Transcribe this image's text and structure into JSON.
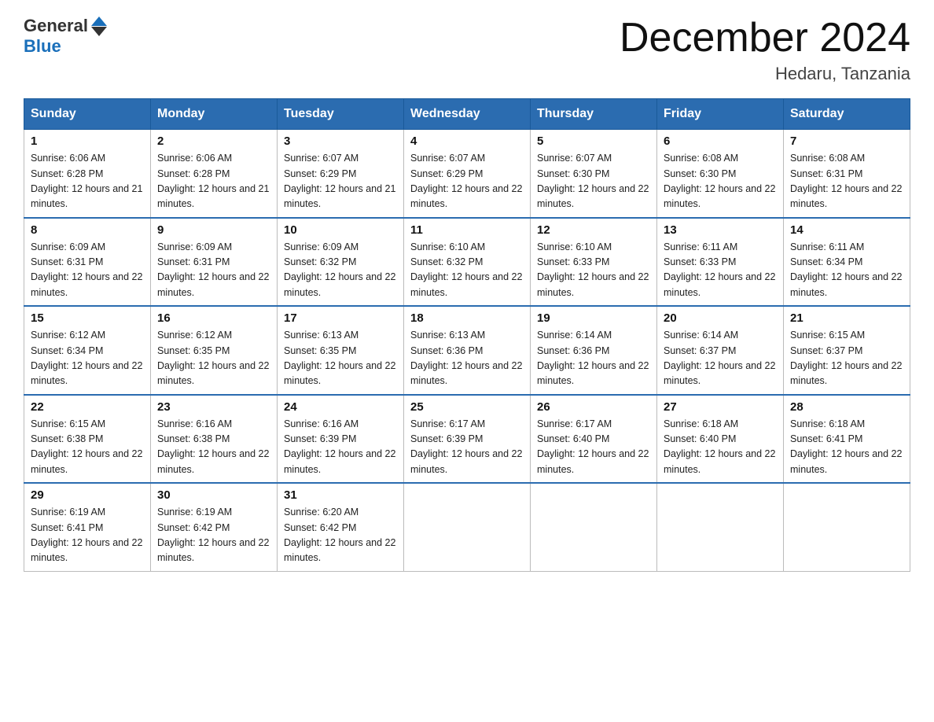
{
  "logo": {
    "text_general": "General",
    "text_blue": "Blue"
  },
  "title": "December 2024",
  "subtitle": "Hedaru, Tanzania",
  "days_of_week": [
    "Sunday",
    "Monday",
    "Tuesday",
    "Wednesday",
    "Thursday",
    "Friday",
    "Saturday"
  ],
  "weeks": [
    [
      {
        "day": "1",
        "sunrise": "6:06 AM",
        "sunset": "6:28 PM",
        "daylight": "12 hours and 21 minutes."
      },
      {
        "day": "2",
        "sunrise": "6:06 AM",
        "sunset": "6:28 PM",
        "daylight": "12 hours and 21 minutes."
      },
      {
        "day": "3",
        "sunrise": "6:07 AM",
        "sunset": "6:29 PM",
        "daylight": "12 hours and 21 minutes."
      },
      {
        "day": "4",
        "sunrise": "6:07 AM",
        "sunset": "6:29 PM",
        "daylight": "12 hours and 22 minutes."
      },
      {
        "day": "5",
        "sunrise": "6:07 AM",
        "sunset": "6:30 PM",
        "daylight": "12 hours and 22 minutes."
      },
      {
        "day": "6",
        "sunrise": "6:08 AM",
        "sunset": "6:30 PM",
        "daylight": "12 hours and 22 minutes."
      },
      {
        "day": "7",
        "sunrise": "6:08 AM",
        "sunset": "6:31 PM",
        "daylight": "12 hours and 22 minutes."
      }
    ],
    [
      {
        "day": "8",
        "sunrise": "6:09 AM",
        "sunset": "6:31 PM",
        "daylight": "12 hours and 22 minutes."
      },
      {
        "day": "9",
        "sunrise": "6:09 AM",
        "sunset": "6:31 PM",
        "daylight": "12 hours and 22 minutes."
      },
      {
        "day": "10",
        "sunrise": "6:09 AM",
        "sunset": "6:32 PM",
        "daylight": "12 hours and 22 minutes."
      },
      {
        "day": "11",
        "sunrise": "6:10 AM",
        "sunset": "6:32 PM",
        "daylight": "12 hours and 22 minutes."
      },
      {
        "day": "12",
        "sunrise": "6:10 AM",
        "sunset": "6:33 PM",
        "daylight": "12 hours and 22 minutes."
      },
      {
        "day": "13",
        "sunrise": "6:11 AM",
        "sunset": "6:33 PM",
        "daylight": "12 hours and 22 minutes."
      },
      {
        "day": "14",
        "sunrise": "6:11 AM",
        "sunset": "6:34 PM",
        "daylight": "12 hours and 22 minutes."
      }
    ],
    [
      {
        "day": "15",
        "sunrise": "6:12 AM",
        "sunset": "6:34 PM",
        "daylight": "12 hours and 22 minutes."
      },
      {
        "day": "16",
        "sunrise": "6:12 AM",
        "sunset": "6:35 PM",
        "daylight": "12 hours and 22 minutes."
      },
      {
        "day": "17",
        "sunrise": "6:13 AM",
        "sunset": "6:35 PM",
        "daylight": "12 hours and 22 minutes."
      },
      {
        "day": "18",
        "sunrise": "6:13 AM",
        "sunset": "6:36 PM",
        "daylight": "12 hours and 22 minutes."
      },
      {
        "day": "19",
        "sunrise": "6:14 AM",
        "sunset": "6:36 PM",
        "daylight": "12 hours and 22 minutes."
      },
      {
        "day": "20",
        "sunrise": "6:14 AM",
        "sunset": "6:37 PM",
        "daylight": "12 hours and 22 minutes."
      },
      {
        "day": "21",
        "sunrise": "6:15 AM",
        "sunset": "6:37 PM",
        "daylight": "12 hours and 22 minutes."
      }
    ],
    [
      {
        "day": "22",
        "sunrise": "6:15 AM",
        "sunset": "6:38 PM",
        "daylight": "12 hours and 22 minutes."
      },
      {
        "day": "23",
        "sunrise": "6:16 AM",
        "sunset": "6:38 PM",
        "daylight": "12 hours and 22 minutes."
      },
      {
        "day": "24",
        "sunrise": "6:16 AM",
        "sunset": "6:39 PM",
        "daylight": "12 hours and 22 minutes."
      },
      {
        "day": "25",
        "sunrise": "6:17 AM",
        "sunset": "6:39 PM",
        "daylight": "12 hours and 22 minutes."
      },
      {
        "day": "26",
        "sunrise": "6:17 AM",
        "sunset": "6:40 PM",
        "daylight": "12 hours and 22 minutes."
      },
      {
        "day": "27",
        "sunrise": "6:18 AM",
        "sunset": "6:40 PM",
        "daylight": "12 hours and 22 minutes."
      },
      {
        "day": "28",
        "sunrise": "6:18 AM",
        "sunset": "6:41 PM",
        "daylight": "12 hours and 22 minutes."
      }
    ],
    [
      {
        "day": "29",
        "sunrise": "6:19 AM",
        "sunset": "6:41 PM",
        "daylight": "12 hours and 22 minutes."
      },
      {
        "day": "30",
        "sunrise": "6:19 AM",
        "sunset": "6:42 PM",
        "daylight": "12 hours and 22 minutes."
      },
      {
        "day": "31",
        "sunrise": "6:20 AM",
        "sunset": "6:42 PM",
        "daylight": "12 hours and 22 minutes."
      },
      null,
      null,
      null,
      null
    ]
  ]
}
